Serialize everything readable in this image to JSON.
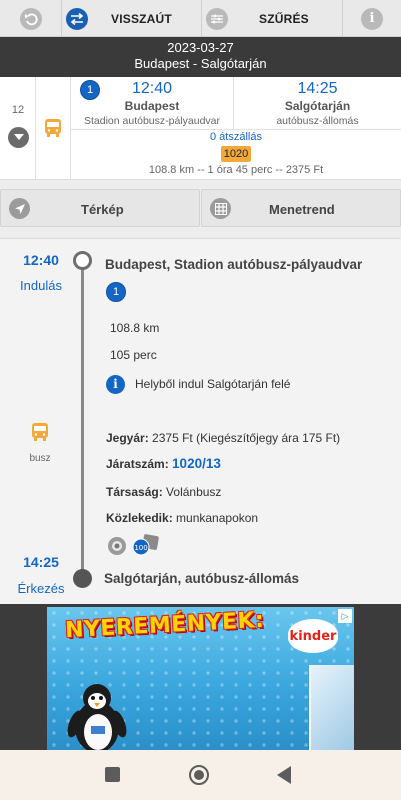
{
  "toolbar": {
    "swap_label": "VISSZAÚT",
    "filter_label": "SZŰRÉS"
  },
  "header": {
    "date": "2023-03-27",
    "route": "Budapest - Salgótarján"
  },
  "route_summary": {
    "row_number": "12",
    "leg_badge": "1",
    "departure_time": "12:40",
    "departure_city": "Budapest",
    "departure_stop": "Stadion autóbusz-pályaudvar",
    "arrival_time": "14:25",
    "arrival_city": "Salgótarján",
    "arrival_stop": "autóbusz-állomás",
    "transfers": "0 átszállás",
    "line_number": "1020",
    "summary": "108.8 km -- 1 óra 45 perc -- 2375 Ft"
  },
  "actions": {
    "map_label": "Térkép",
    "timetable_label": "Menetrend"
  },
  "detail": {
    "departure_time": "12:40",
    "departure_label": "Indulás",
    "departure_stop": "Budapest, Stadion autóbusz-pályaudvar",
    "leg_badge": "1",
    "distance": "108.8 km",
    "duration": "105 perc",
    "info_text": "Helyből indul Salgótarján felé",
    "vehicle_label": "busz",
    "ticket_key": "Jegyár:",
    "ticket_value": "2375 Ft (Kiegészítőjegy ára 175 Ft)",
    "service_key": "Járatszám:",
    "service_value": "1020/13",
    "company_key": "Társaság:",
    "company_value": "Volánbusz",
    "runs_key": "Közlekedik:",
    "runs_value": "munkanapokon",
    "arrival_time": "14:25",
    "arrival_label": "Érkezés",
    "arrival_stop": "Salgótarján, autóbusz-állomás"
  },
  "ad": {
    "headline": "NYEREMÉNYEK:",
    "brand": "kinder"
  },
  "colors": {
    "accent_blue": "#1466c5",
    "line_badge": "#f3a93a",
    "header_dark": "#3a3a3a",
    "bus_orange": "#f3a93a"
  }
}
